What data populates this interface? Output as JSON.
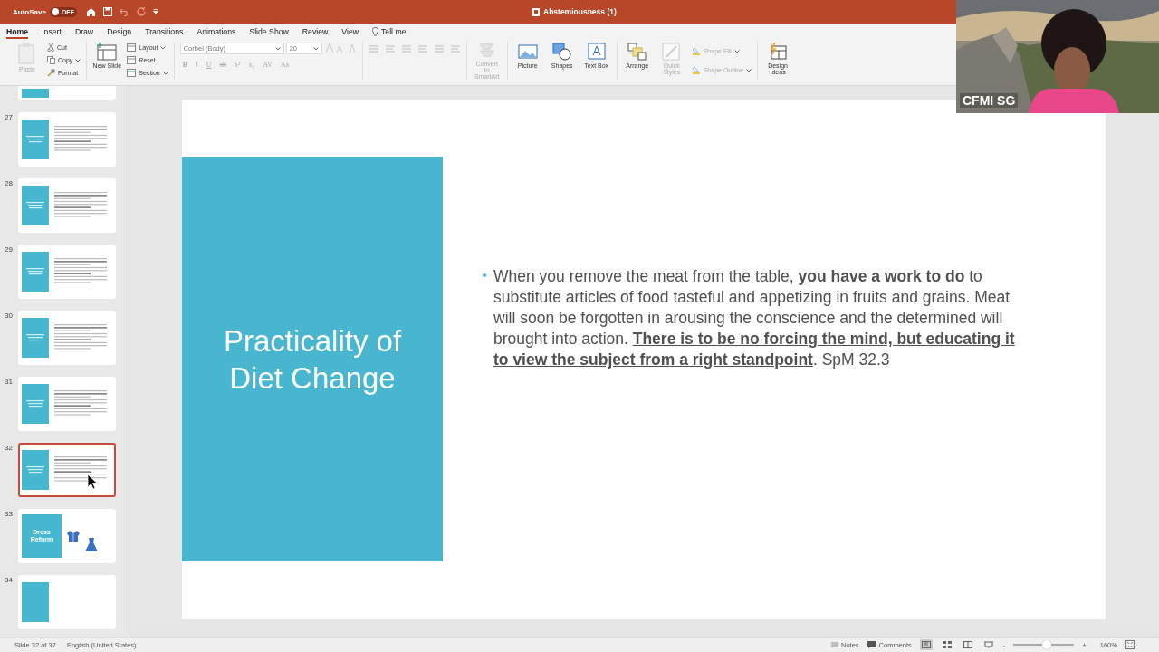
{
  "title_bar": {
    "autosave": {
      "label": "AutoSave",
      "on": false,
      "state_label": "OFF"
    },
    "document_title": "Abstemiousness (1)"
  },
  "tabs": [
    {
      "label": "Home",
      "selected": true,
      "kind": "tab"
    },
    {
      "label": "Insert",
      "selected": false,
      "kind": "tab"
    },
    {
      "label": "Draw",
      "selected": false,
      "kind": "tab"
    },
    {
      "label": "Design",
      "selected": false,
      "kind": "tab"
    },
    {
      "label": "Transitions",
      "selected": false,
      "kind": "tab"
    },
    {
      "label": "Animations",
      "selected": false,
      "kind": "tab"
    },
    {
      "label": "Slide Show",
      "selected": false,
      "kind": "tab"
    },
    {
      "label": "Review",
      "selected": false,
      "kind": "tab"
    },
    {
      "label": "View",
      "selected": false,
      "kind": "tab"
    },
    {
      "label": "Tell me",
      "selected": false,
      "kind": "search"
    }
  ],
  "ribbon": {
    "paste": {
      "label": "Paste",
      "disabled": true
    },
    "clipboard_actions": [
      {
        "label": "Cut",
        "disabled": false
      },
      {
        "label": "Copy",
        "disabled": false
      },
      {
        "label": "Format",
        "disabled": false
      }
    ],
    "new_slide": {
      "label": "New Slide",
      "disabled": false
    },
    "slide_actions": [
      {
        "label": "Layout",
        "disabled": false
      },
      {
        "label": "Reset",
        "disabled": false
      },
      {
        "label": "Section",
        "disabled": false
      }
    ],
    "font_field": {
      "value": "Corbel (Body)"
    },
    "size_field": {
      "value": "20"
    },
    "format_buttons": [
      {
        "label": "B",
        "disabled": true
      },
      {
        "label": "I",
        "disabled": true
      },
      {
        "label": "U",
        "disabled": true
      },
      {
        "label": "ab",
        "disabled": true
      },
      {
        "label": "x²",
        "disabled": true
      },
      {
        "label": "x₂",
        "disabled": true
      },
      {
        "label": "AV",
        "disabled": true
      },
      {
        "label": "Aa",
        "disabled": true
      }
    ],
    "smartart": {
      "label": "Convert to SmartArt",
      "disabled": true
    },
    "insert_buttons": [
      {
        "label": "Picture",
        "disabled": false
      },
      {
        "label": "Shapes",
        "disabled": false
      },
      {
        "label": "Text Box",
        "disabled": false
      }
    ],
    "arrange": {
      "label": "Arrange",
      "disabled": false
    },
    "quick_styles": {
      "label": "Quick Styles",
      "disabled": true
    },
    "shape_actions": [
      {
        "label": "Shape Fill",
        "disabled": true
      },
      {
        "label": "Shape Outline",
        "disabled": true
      }
    ],
    "design_ideas": {
      "label": "Design Ideas",
      "disabled": false
    }
  },
  "thumbnails": [
    {
      "kind": "cut",
      "selected": false
    },
    {
      "number": "27",
      "kind": "text",
      "selected": false
    },
    {
      "number": "28",
      "kind": "text",
      "selected": false
    },
    {
      "number": "29",
      "kind": "text",
      "selected": false
    },
    {
      "number": "30",
      "kind": "text",
      "selected": false
    },
    {
      "number": "31",
      "kind": "text",
      "selected": false
    },
    {
      "number": "32",
      "kind": "text",
      "selected": true
    },
    {
      "number": "33",
      "kind": "dress",
      "title": "Dress Reform",
      "selected": false
    },
    {
      "number": "34",
      "kind": "blank",
      "selected": false
    }
  ],
  "slide": {
    "title": "Practicality of Diet Change",
    "bullet": "When you remove the meat from the table, **you have a work to do** to substitute articles of food tasteful and appetizing in fruits and grains. Meat will soon be forgotten in arousing the conscience and the determined will brought into action. **There is to be no forcing the mind, but educating it to view the subject from a right standpoint**. SpM 32.3"
  },
  "video": {
    "name": "CFMI SG"
  },
  "status_bar": {
    "slide_position": "Slide 32 of 37",
    "language": "English (United States)",
    "notes": "Notes",
    "comments": "Comments",
    "views": [
      {
        "selected": true
      },
      {
        "selected": false
      },
      {
        "selected": false
      },
      {
        "selected": false
      }
    ],
    "zoom_minus": "-",
    "zoom_plus": "+",
    "zoom": {
      "level": 0.55
    },
    "zoom_label": "160%"
  }
}
